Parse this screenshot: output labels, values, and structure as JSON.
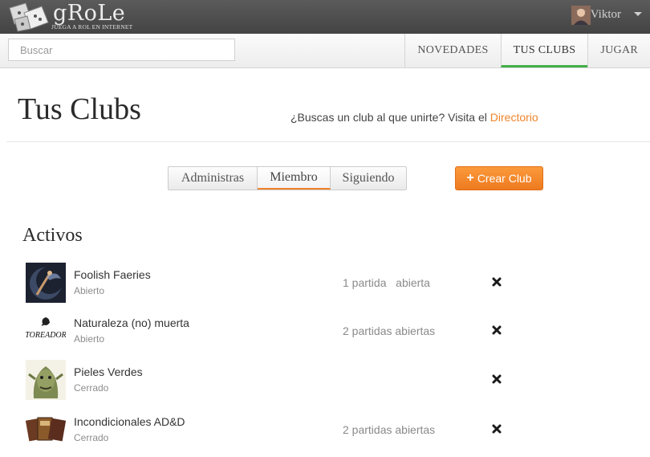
{
  "header": {
    "logo_text": "gRoLe",
    "logo_tagline": "JUEGA A ROL EN INTERNET",
    "user_name": "Viktor"
  },
  "search": {
    "placeholder": "Buscar"
  },
  "nav": {
    "tabs": [
      {
        "label": "NOVEDADES",
        "active": false
      },
      {
        "label": "TUS CLUBS",
        "active": true
      },
      {
        "label": "JUGAR",
        "active": false
      }
    ]
  },
  "page": {
    "title": "Tus Clubs",
    "hint_text": "¿Buscas un club al que unirte? Visita el",
    "hint_link": "Directorio"
  },
  "filters": {
    "tabs": [
      {
        "label": "Administras",
        "active": false
      },
      {
        "label": "Miembro",
        "active": true
      },
      {
        "label": "Siguiendo",
        "active": false
      }
    ],
    "create_label": "Crear Club"
  },
  "section": {
    "title": "Activos",
    "clubs": [
      {
        "name": "Foolish Faeries",
        "status": "Abierto",
        "games": "1 partida   abierta",
        "thumb": "fairy-moon-icon"
      },
      {
        "name": "Naturaleza (no) muerta",
        "status": "Abierto",
        "games": "2 partidas abiertas",
        "thumb": "toreador-rose-icon",
        "thumb_text": "TOREADOR"
      },
      {
        "name": "Pieles Verdes",
        "status": "Cerrado",
        "games": "",
        "thumb": "orc-face-icon"
      },
      {
        "name": "Incondicionales AD&D",
        "status": "Cerrado",
        "games": "2 partidas abiertas",
        "thumb": "rulebooks-icon"
      }
    ]
  },
  "colors": {
    "accent": "#f0842a",
    "nav_active_underline": "#43b04a",
    "topbar": "#4a4a4a"
  }
}
